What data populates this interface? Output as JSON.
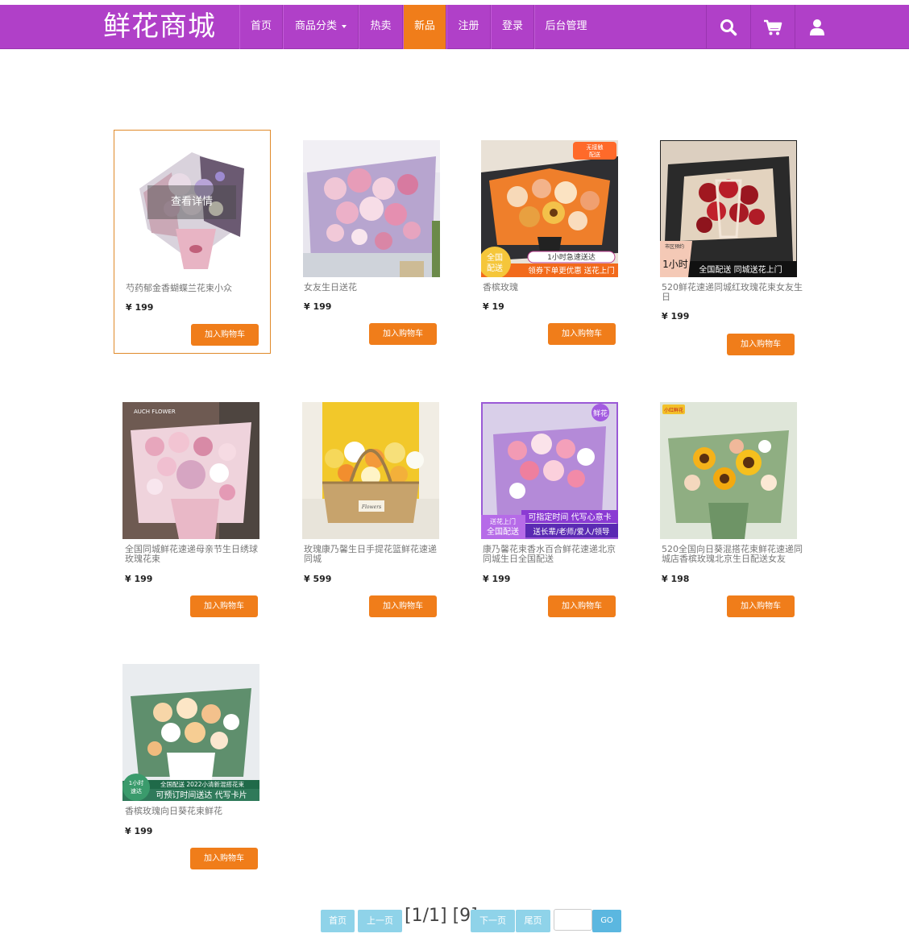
{
  "brand": "鲜花商城",
  "nav": {
    "home": "首页",
    "category": "商品分类",
    "hot": "热卖",
    "new": "新品",
    "register": "注册",
    "login": "登录",
    "admin": "后台管理"
  },
  "nav_icons": [
    "search-icon",
    "cart-icon",
    "user-icon"
  ],
  "colors": {
    "navbar": "#b040c8",
    "active": "#f07d1a",
    "button": "#f07d1a",
    "pager": "#8fd3e9",
    "go": "#5bb7e0"
  },
  "overlay_label": "查看详情",
  "add_to_cart": "加入购物车",
  "products": [
    {
      "name": "芍药郁金香蝴蝶兰花束小众",
      "price": "¥ 199"
    },
    {
      "name": "女友生日送花",
      "price": "¥ 199"
    },
    {
      "name": "香槟玫瑰",
      "price": "¥ 19"
    },
    {
      "name": "520鲜花速递同城红玫瑰花束女友生日",
      "price": "¥ 199"
    },
    {
      "name": "全国同城鲜花速递母亲节生日绣球玫瑰花束",
      "price": "¥ 199"
    },
    {
      "name": "玫瑰康乃馨生日手提花篮鲜花速递同城",
      "price": "¥ 599"
    },
    {
      "name": "康乃馨花束香水百合鲜花速递北京同城生日全国配送",
      "price": "¥ 199"
    },
    {
      "name": "520全国向日葵混搭花束鲜花速递同城店香槟玫瑰北京生日配送女友",
      "price": "¥ 198"
    },
    {
      "name": "香槟玫瑰向日葵花束鲜花",
      "price": "¥ 199"
    }
  ],
  "image_text": {
    "p3_badge": "无接触\n配送",
    "p3_banner1": "1小时急速送达",
    "p3_corner": "全国\n配送",
    "p3_banner2": "领券下单更优惠 送花上门",
    "p4_corner": "1小时",
    "p4_corner_small": "市区预约",
    "p4_banner": "全国配送 同城送花上门",
    "p5_logo": "AUCH FLOWER",
    "p6_tag": "Flowers",
    "p7_badge": "鲜花",
    "p7_banner1": "可指定时间 代写心意卡",
    "p7_corner": "送花上门\n全国配送",
    "p7_banner2": "送长辈/老师/爱人/领导",
    "p8_logo": "小红鲜花",
    "p9_corner": "1小时\n速达",
    "p9_banner1": "全国配送 2022小清新混搭花束",
    "p9_banner2": "可预订时间送达 代写卡片"
  },
  "pager": {
    "first": "首页",
    "prev": "上一页",
    "info": "[1/1] [9]",
    "next": "下一页",
    "last": "尾页",
    "go": "GO",
    "input_value": ""
  }
}
